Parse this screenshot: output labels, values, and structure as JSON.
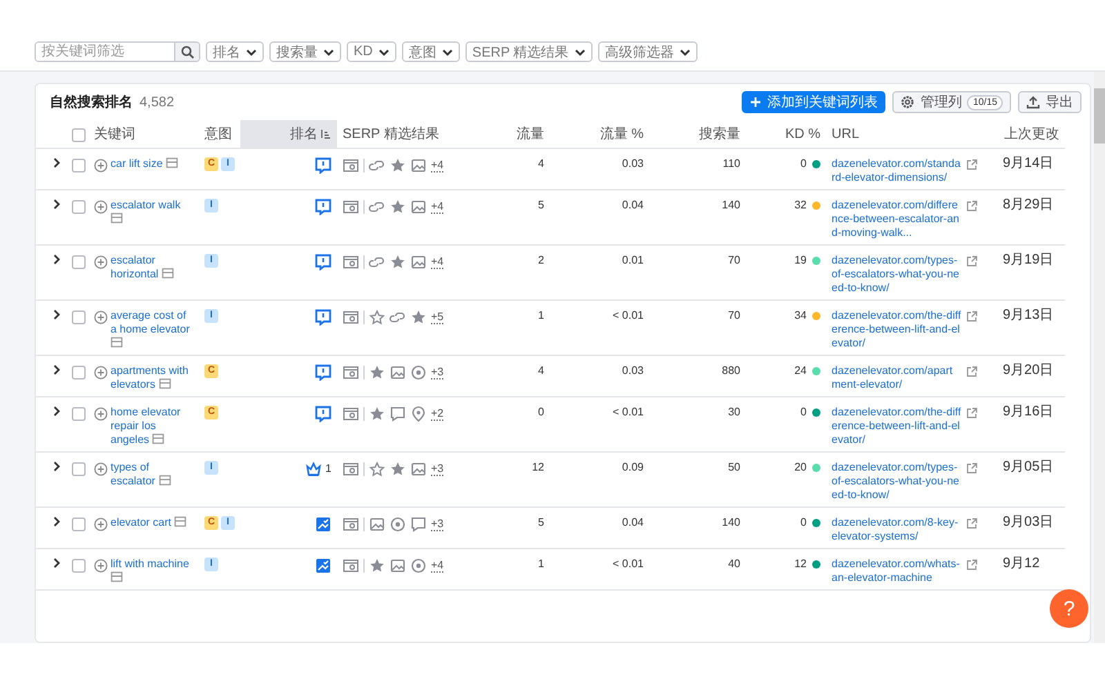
{
  "filters": {
    "search_placeholder": "按关键词筛选",
    "dropdowns": [
      "排名",
      "搜索量",
      "KD",
      "意图",
      "SERP 精选结果",
      "高级筛选器"
    ]
  },
  "panel": {
    "title": "自然搜索排名",
    "count": "4,582",
    "buttons": [
      {
        "kind": "add",
        "label": "添加到关键词列表"
      },
      {
        "kind": "columns",
        "label": "管理列",
        "badge": "10/15"
      },
      {
        "kind": "export",
        "label": "导出"
      }
    ]
  },
  "table": {
    "select_all": {
      "checked": false
    },
    "columns": [
      {
        "label": "关键词",
        "sorted": false
      },
      {
        "label": "意图",
        "sorted": false
      },
      {
        "label": "排名",
        "sorted": true
      },
      {
        "label": "SERP 精选结果",
        "sorted": false
      },
      {
        "label": "流量",
        "sorted": false
      },
      {
        "label": "流量 %",
        "sorted": false
      },
      {
        "label": "搜索量",
        "sorted": false
      },
      {
        "label": "KD %",
        "sorted": false
      },
      {
        "label": "URL",
        "sorted": false
      },
      {
        "label": "上次更改",
        "sorted": false
      }
    ],
    "rows": [
      {
        "checked": false,
        "keyword": "car lift size",
        "intents": [
          {
            "label": "C",
            "kind": "commercial"
          },
          {
            "label": "I",
            "kind": "informational"
          }
        ],
        "rank": {
          "kind": "snippet"
        },
        "features": [
          {
            "kind": "link"
          },
          {
            "kind": "star"
          },
          {
            "kind": "image"
          }
        ],
        "more": "+4",
        "traffic": "4",
        "traffic_pct": "0.03",
        "volume": "110",
        "kd": {
          "value": "0",
          "color": "#009f81"
        },
        "url": "dazenelevator.com/standard-elevator-dimensions/",
        "updated": "9月14日"
      },
      {
        "checked": false,
        "keyword": "escalator walk",
        "intents": [
          {
            "label": "I",
            "kind": "informational"
          }
        ],
        "rank": {
          "kind": "snippet"
        },
        "features": [
          {
            "kind": "link"
          },
          {
            "kind": "star"
          },
          {
            "kind": "image"
          }
        ],
        "more": "+4",
        "traffic": "5",
        "traffic_pct": "0.04",
        "volume": "140",
        "kd": {
          "value": "32",
          "color": "#fcb72b"
        },
        "url": "dazenelevator.com/difference-between-escalator-and-moving-walk...",
        "updated": "8月29日"
      },
      {
        "checked": false,
        "keyword": "escalator horizontal",
        "intents": [
          {
            "label": "I",
            "kind": "informational"
          }
        ],
        "rank": {
          "kind": "snippet"
        },
        "features": [
          {
            "kind": "link"
          },
          {
            "kind": "star"
          },
          {
            "kind": "image"
          }
        ],
        "more": "+4",
        "traffic": "2",
        "traffic_pct": "0.01",
        "volume": "70",
        "kd": {
          "value": "19",
          "color": "#59ddaa"
        },
        "url": "dazenelevator.com/types-of-escalators-what-you-need-to-know/",
        "updated": "9月19日"
      },
      {
        "checked": false,
        "keyword": "average cost of a home elevator",
        "intents": [
          {
            "label": "I",
            "kind": "informational"
          }
        ],
        "rank": {
          "kind": "snippet"
        },
        "features": [
          {
            "kind": "star-outline"
          },
          {
            "kind": "link"
          },
          {
            "kind": "star"
          }
        ],
        "more": "+5",
        "traffic": "1",
        "traffic_pct": "< 0.01",
        "volume": "70",
        "kd": {
          "value": "34",
          "color": "#fcb72b"
        },
        "url": "dazenelevator.com/the-difference-between-lift-and-elevator/",
        "updated": "9月13日"
      },
      {
        "checked": false,
        "keyword": "apartments with elevators",
        "intents": [
          {
            "label": "C",
            "kind": "commercial"
          }
        ],
        "rank": {
          "kind": "snippet"
        },
        "features": [
          {
            "kind": "star"
          },
          {
            "kind": "image"
          },
          {
            "kind": "target"
          }
        ],
        "more": "+3",
        "traffic": "4",
        "traffic_pct": "0.03",
        "volume": "880",
        "kd": {
          "value": "24",
          "color": "#59ddaa"
        },
        "url": "dazenelevator.com/apartment-elevator/",
        "updated": "9月20日"
      },
      {
        "checked": false,
        "keyword": "home elevator repair los angeles",
        "intents": [
          {
            "label": "C",
            "kind": "commercial"
          }
        ],
        "rank": {
          "kind": "snippet"
        },
        "features": [
          {
            "kind": "star"
          },
          {
            "kind": "comment"
          },
          {
            "kind": "pin"
          }
        ],
        "more": "+2",
        "traffic": "0",
        "traffic_pct": "< 0.01",
        "volume": "30",
        "kd": {
          "value": "0",
          "color": "#009f81"
        },
        "url": "dazenelevator.com/the-difference-between-lift-and-elevator/",
        "updated": "9月16日"
      },
      {
        "checked": false,
        "keyword": "types of escalator",
        "intents": [
          {
            "label": "I",
            "kind": "informational"
          }
        ],
        "rank": {
          "kind": "crown",
          "text": "1"
        },
        "features": [
          {
            "kind": "star-outline"
          },
          {
            "kind": "star"
          },
          {
            "kind": "image"
          }
        ],
        "more": "+3",
        "traffic": "12",
        "traffic_pct": "0.09",
        "volume": "50",
        "kd": {
          "value": "20",
          "color": "#59ddaa"
        },
        "url": "dazenelevator.com/types-of-escalators-what-you-need-to-know/",
        "updated": "9月05日"
      },
      {
        "checked": false,
        "keyword": "elevator cart",
        "intents": [
          {
            "label": "C",
            "kind": "commercial"
          },
          {
            "label": "I",
            "kind": "informational"
          }
        ],
        "rank": {
          "kind": "image-check"
        },
        "features": [
          {
            "kind": "image"
          },
          {
            "kind": "target"
          },
          {
            "kind": "comment"
          }
        ],
        "more": "+3",
        "traffic": "5",
        "traffic_pct": "0.04",
        "volume": "140",
        "kd": {
          "value": "0",
          "color": "#009f81"
        },
        "url": "dazenelevator.com/8-key-elevator-systems/",
        "updated": "9月03日"
      },
      {
        "checked": false,
        "keyword": "lift with machine",
        "intents": [
          {
            "label": "I",
            "kind": "informational"
          }
        ],
        "rank": {
          "kind": "image-check"
        },
        "features": [
          {
            "kind": "star"
          },
          {
            "kind": "image"
          },
          {
            "kind": "target"
          }
        ],
        "more": "+4",
        "traffic": "1",
        "traffic_pct": "< 0.01",
        "volume": "40",
        "kd": {
          "value": "12",
          "color": "#009f81"
        },
        "url": "dazenelevator.com/whats-an-elevator-machine",
        "updated": "9月12"
      }
    ]
  },
  "help_button": {
    "label": "?"
  }
}
